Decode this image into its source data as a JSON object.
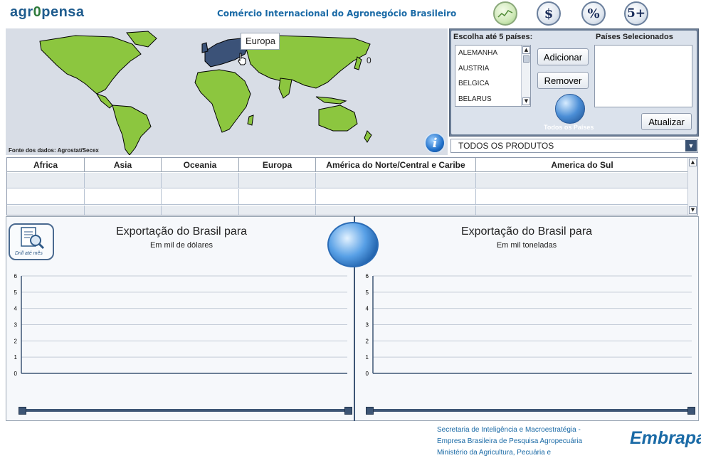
{
  "header": {
    "logo_text": "agr",
    "logo_o": "0",
    "logo_rest": "pensa",
    "title": "Comércio Internacional do Agronegócio Brasileiro",
    "icons": [
      "chart-icon",
      "dollar-icon",
      "percent-icon",
      "five-plus-icon"
    ],
    "dollar_label": "$",
    "percent_label": "%",
    "five_label": "5+"
  },
  "map": {
    "tooltip": "Europa",
    "value": "0",
    "source": "Fonte dos dados: Agrostat/Secex",
    "info_label": "i",
    "colors": {
      "land": "#8cc63f",
      "highlight": "#3b5278",
      "background": "#d8dde6"
    }
  },
  "selector": {
    "choose_label": "Escolha até 5 países:",
    "selected_label": "Países Selecionados",
    "countries": [
      "ALEMANHA",
      "AUSTRIA",
      "BELGICA",
      "BELARUS"
    ],
    "add_label": "Adicionar",
    "remove_label": "Remover",
    "all_countries_label": "Todos os Países",
    "update_label": "Atualizar",
    "product_value": "TODOS OS PRODUTOS"
  },
  "regions": {
    "headers": [
      "Africa",
      "Asia",
      "Oceania",
      "Europa",
      "América do Norte/Central e Caribe",
      "America do Sul"
    ]
  },
  "charts": {
    "drill_label": "Drill até mês",
    "left": {
      "title": "Exportação do Brasil para",
      "subtitle": "Em mil de dólares"
    },
    "right": {
      "title": "Exportação do Brasil para",
      "subtitle": "Em mil toneladas"
    }
  },
  "chart_data": [
    {
      "type": "line",
      "title": "Exportação do Brasil para",
      "subtitle": "Em mil de dólares",
      "y_ticks": [
        "6",
        "5",
        "4",
        "3",
        "2",
        "1",
        "0"
      ],
      "ylim": [
        0,
        6
      ],
      "series": [],
      "grid": true
    },
    {
      "type": "line",
      "title": "Exportação do Brasil para",
      "subtitle": "Em mil toneladas",
      "y_ticks": [
        "6",
        "5",
        "4",
        "3",
        "2",
        "1",
        "0"
      ],
      "ylim": [
        0,
        6
      ],
      "series": [],
      "grid": true
    }
  ],
  "footer": {
    "lines": [
      "Secretaria de Inteligência e Macroestratégia -",
      "Empresa Brasileira de Pesquisa Agropecuária",
      "Ministério da Agricultura, Pecuária e"
    ],
    "brand": "Embrapa"
  }
}
